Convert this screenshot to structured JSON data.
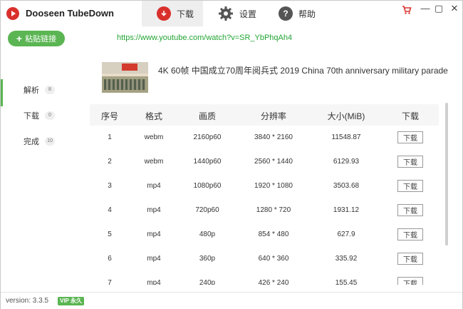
{
  "app": {
    "title": "Dooseen TubeDown"
  },
  "tabs": [
    {
      "label": "下载",
      "icon": "download-icon",
      "active": true
    },
    {
      "label": "设置",
      "icon": "gear-icon",
      "active": false
    },
    {
      "label": "帮助",
      "icon": "help-icon",
      "active": false
    }
  ],
  "toolbar": {
    "paste_label": "粘贴链接",
    "url": "https://www.youtube.com/watch?v=SR_YbPhqAh4"
  },
  "sidebar": {
    "items": [
      {
        "label": "解析",
        "count": "8",
        "active": true
      },
      {
        "label": "下载",
        "count": "0",
        "active": false
      },
      {
        "label": "完成",
        "count": "10",
        "active": false
      }
    ]
  },
  "video": {
    "title": "4K 60帧 中国成立70周年阅兵式 2019 China 70th anniversary military parade"
  },
  "table": {
    "headers": [
      "序号",
      "格式",
      "画质",
      "分辨率",
      "大小(MiB)",
      "下载"
    ],
    "download_label": "下载",
    "rows": [
      {
        "index": "1",
        "format": "webm",
        "quality": "2160p60",
        "resolution": "3840 * 2160",
        "size": "11548.87"
      },
      {
        "index": "2",
        "format": "webm",
        "quality": "1440p60",
        "resolution": "2560 * 1440",
        "size": "6129.93"
      },
      {
        "index": "3",
        "format": "mp4",
        "quality": "1080p60",
        "resolution": "1920 * 1080",
        "size": "3503.68"
      },
      {
        "index": "4",
        "format": "mp4",
        "quality": "720p60",
        "resolution": "1280 * 720",
        "size": "1931.12"
      },
      {
        "index": "5",
        "format": "mp4",
        "quality": "480p",
        "resolution": "854 * 480",
        "size": "627.9"
      },
      {
        "index": "6",
        "format": "mp4",
        "quality": "360p",
        "resolution": "640 * 360",
        "size": "335.92"
      },
      {
        "index": "7",
        "format": "mp4",
        "quality": "240p",
        "resolution": "426 * 240",
        "size": "155.45"
      }
    ]
  },
  "footer": {
    "version": "version: 3.3.5",
    "vip_label": "VIP 永久"
  },
  "colors": {
    "accent_green": "#5ab552",
    "brand_red": "#d9302c",
    "url_green": "#23a535"
  }
}
